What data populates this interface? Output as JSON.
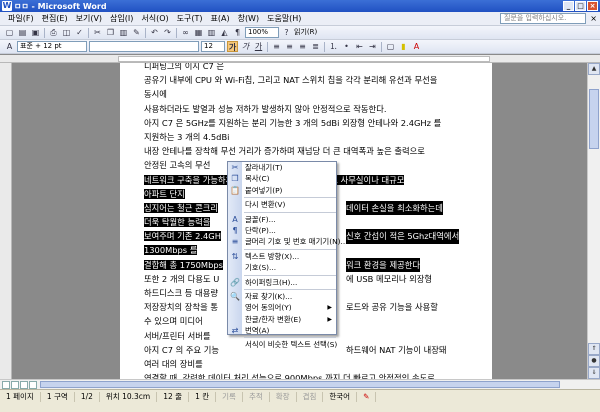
{
  "window": {
    "title": "ㅁㅁ - Microsoft Word",
    "buttons": [
      "_",
      "□",
      "×"
    ]
  },
  "menubar": {
    "items": [
      "파일(F)",
      "편집(E)",
      "보기(V)",
      "삽입(I)",
      "서식(O)",
      "도구(T)",
      "표(A)",
      "창(W)",
      "도움말(H)"
    ],
    "help_placeholder": "질문을 입력하십시오.",
    "close": "×"
  },
  "toolbar1": {
    "zoom": "100%",
    "read_label": "읽기(R)"
  },
  "toolbar2": {
    "style": "표준 + 12 pt",
    "font": "",
    "size": "12",
    "bold": "가",
    "italic": "가",
    "underline": "가"
  },
  "document": {
    "lines": [
      {
        "text": "디퍼팅그의 이지 C7 은",
        "highlight": false
      },
      {
        "text": "공유기 내부에 CPU 와 Wi-Fi칩, 그리고 NAT 스위치 칩을 각각 분리해 유선과 무선을",
        "highlight": false
      },
      {
        "text": "동시에",
        "highlight": false
      },
      {
        "text": "사용하더라도 발열과 성능 저하가 발생하지 않아 안정적으로 작동한다.",
        "highlight": false
      },
      {
        "text": "아지 C7 은 5GHz를 지원하는 분리 기능한 3 개의 5dBi 외장형 안테나와 2.4GHz 를",
        "highlight": false
      },
      {
        "text": "지원하는 3 개의 4.5dBi",
        "highlight": false
      },
      {
        "text": "내장 안테나를 장착해 무선 거리가 증가하며 재넘당 더 큰 대역폭과 높은 출력으로",
        "highlight": false
      },
      {
        "text": "안정된 고속의 무선",
        "highlight": false
      },
      {
        "text": "네트워크 구축을 가능하게 한다. 이로써 가정이나 소규모 사무실이나 대규모",
        "highlight": true
      },
      {
        "text": "아파트 단지",
        "highlight": true
      },
      {
        "text": "심지어는 철근 콘크리",
        "highlight": true
      },
      {
        "text": "더욱 탁월한 능력을",
        "highlight": true
      },
      {
        "text": "보여주며 기존 2.4GH",
        "highlight": true
      },
      {
        "text": "1300Mbps 를",
        "highlight": true
      },
      {
        "text": "결합해 총 1750Mbps",
        "highlight": true
      },
      {
        "text": "또한 2 개의 다용도 U",
        "highlight": false
      },
      {
        "text": "하드디스크 등 대용량",
        "highlight": false
      },
      {
        "text": "저장장치의 장착을 통",
        "highlight": false
      },
      {
        "text": "수 있으며 미디어",
        "highlight": false
      },
      {
        "text": "서버/프린터 서버를",
        "highlight": false
      },
      {
        "text": "아지 C7 의 주요 기능",
        "highlight": false
      },
      {
        "text": "여러 대의 장비를",
        "highlight": false
      },
      {
        "text": "연결할 때, 강력한 데이터 처리 성능으로 900Mbps 까지 더 빠르고 안정적인 속도로",
        "highlight": false
      },
      {
        "text": "사용자의 경험을",
        "highlight": false
      },
      {
        "text": "향상시킨다. 자세대 인터넷 프로토콜인 IPv6 를 지원하며 USB 설정, 거 1스트 네트워크,",
        "highlight": false
      },
      {
        "text": "DHCP, QoS 설정",
        "highlight": false
      }
    ],
    "right_fragments": [
      {
        "row": 10,
        "text": "데이터 손실을 최소화하는데",
        "highlight": true
      },
      {
        "row": 12,
        "text": "신호 간섭이 적은 5Ghz대역에서",
        "highlight": true
      },
      {
        "row": 14,
        "text": "워크 환경을 제공한다",
        "highlight": true
      },
      {
        "row": 15,
        "text": "에 USB 메모리나 외장형",
        "highlight": false
      },
      {
        "row": 17,
        "text": "로드와 공유 기능을 사용할",
        "highlight": false
      },
      {
        "row": 20,
        "text": "하드웨어 NAT 기능이 내장돼",
        "highlight": false
      }
    ]
  },
  "context_menu": {
    "items": [
      {
        "label": "잘라내기(T)",
        "icon": "cut-icon",
        "glyph": "✂",
        "sep_after": false,
        "sub": false
      },
      {
        "label": "복사(C)",
        "icon": "copy-icon",
        "glyph": "❐",
        "sep_after": false,
        "sub": false
      },
      {
        "label": "붙여넣기(P)",
        "icon": "paste-icon",
        "glyph": "📋",
        "sep_after": true,
        "sub": false
      },
      {
        "label": "다시 변환(V)",
        "icon": "",
        "glyph": "",
        "sep_after": true,
        "sub": false
      },
      {
        "label": "글꼴(F)...",
        "icon": "font-icon",
        "glyph": "A",
        "sep_after": false,
        "sub": false
      },
      {
        "label": "단락(P)...",
        "icon": "paragraph-icon",
        "glyph": "¶",
        "sep_after": false,
        "sub": false
      },
      {
        "label": "글머리 기호 및 번호 매기기(N)...",
        "icon": "bullets-icon",
        "glyph": "≡",
        "sep_after": true,
        "sub": false
      },
      {
        "label": "텍스트 방향(X)...",
        "icon": "text-direction-icon",
        "glyph": "⇅",
        "sep_after": false,
        "sub": false
      },
      {
        "label": "기호(S)...",
        "icon": "",
        "glyph": "",
        "sep_after": true,
        "sub": false
      },
      {
        "label": "하이퍼링크(H)...",
        "icon": "hyperlink-icon",
        "glyph": "🔗",
        "sep_after": true,
        "sub": false
      },
      {
        "label": "자료 찾기(K)...",
        "icon": "research-icon",
        "glyph": "🔍",
        "sep_after": false,
        "sub": false
      },
      {
        "label": "영어 동의어(Y)",
        "icon": "",
        "glyph": "",
        "sep_after": false,
        "sub": true
      },
      {
        "label": "한글/한자 변환(E)",
        "icon": "",
        "glyph": "",
        "sep_after": false,
        "sub": true
      },
      {
        "label": "번역(A)",
        "icon": "translate-icon",
        "glyph": "⇄",
        "sep_after": true,
        "sub": false
      },
      {
        "label": "서식이 비슷한 텍스트 선택(S)",
        "icon": "",
        "glyph": "",
        "sep_after": false,
        "sub": false
      }
    ]
  },
  "statusbar": {
    "page": "1 페이지",
    "section": "1 구역",
    "pages": "1/2",
    "position": "위치 10.3cm",
    "line": "12 줄",
    "column": "1 칸",
    "modes": [
      "기록",
      "추적",
      "확장",
      "겹침"
    ],
    "language": "한국어"
  }
}
